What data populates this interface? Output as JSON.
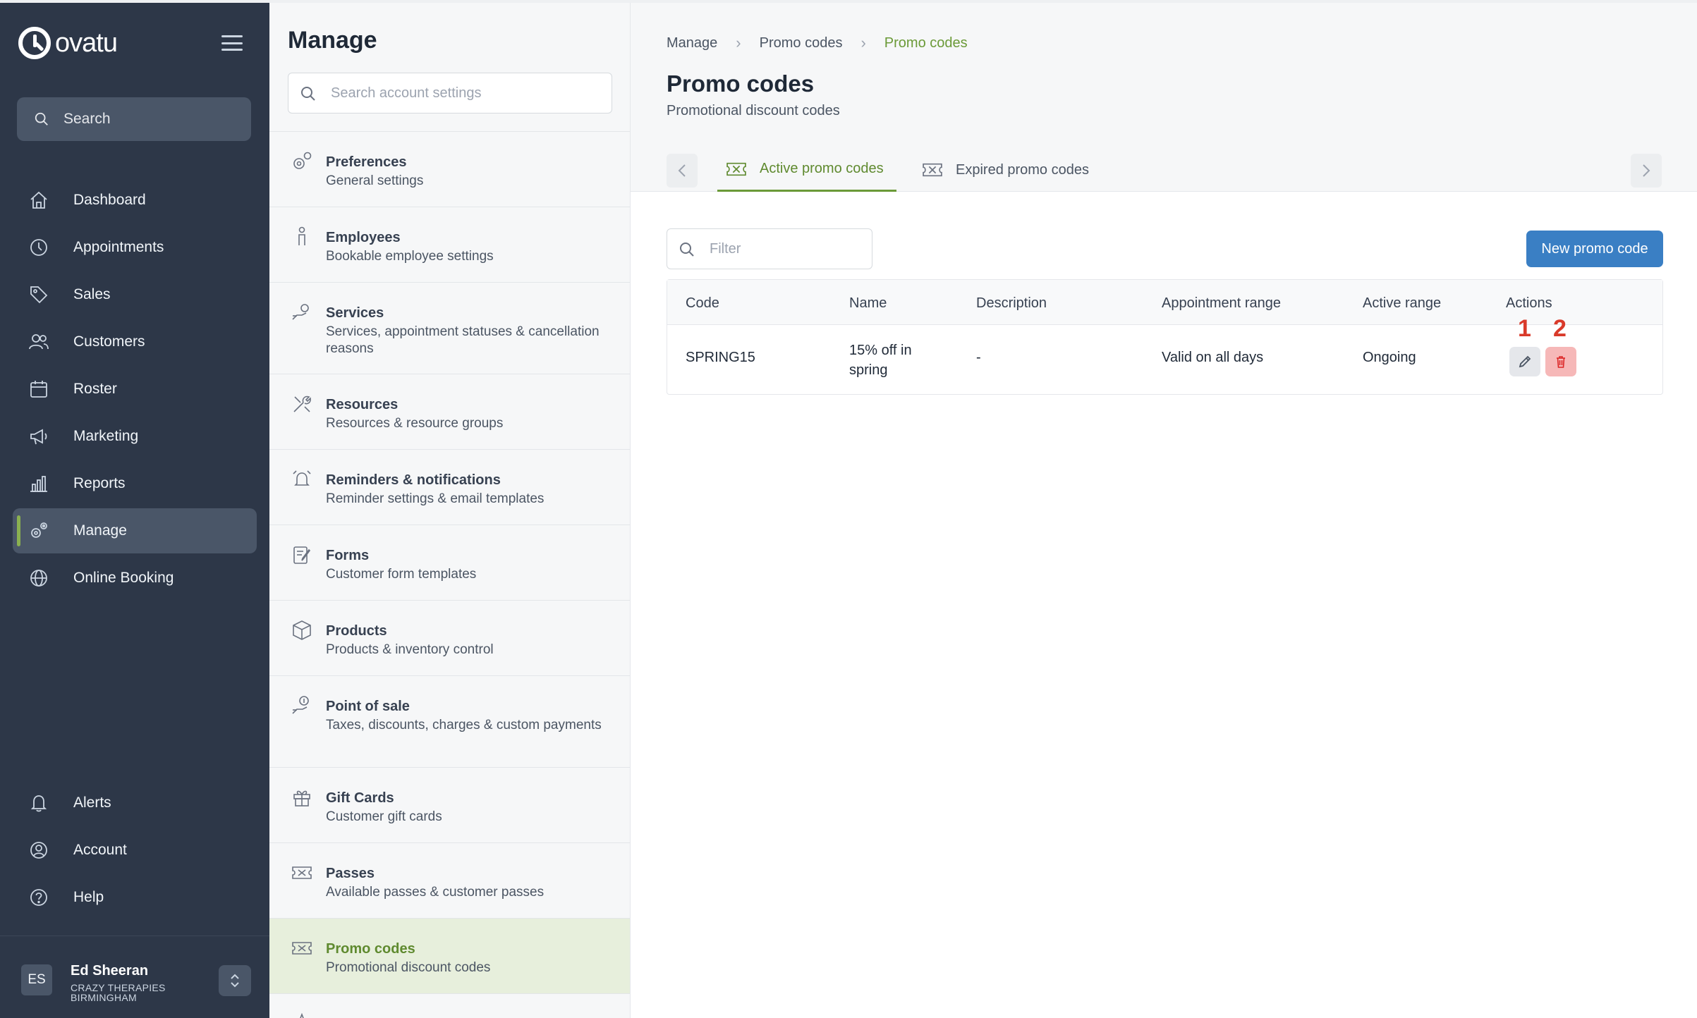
{
  "app": {
    "logo": "ovatu"
  },
  "nav": {
    "search_label": "Search",
    "items": [
      {
        "label": "Dashboard",
        "icon": "home-icon"
      },
      {
        "label": "Appointments",
        "icon": "clock-icon"
      },
      {
        "label": "Sales",
        "icon": "tag-icon"
      },
      {
        "label": "Customers",
        "icon": "users-icon"
      },
      {
        "label": "Roster",
        "icon": "calendar-icon"
      },
      {
        "label": "Marketing",
        "icon": "megaphone-icon"
      },
      {
        "label": "Reports",
        "icon": "bar-chart-icon"
      },
      {
        "label": "Manage",
        "icon": "gears-icon",
        "active": true
      },
      {
        "label": "Online Booking",
        "icon": "globe-icon"
      }
    ],
    "bottom_items": [
      {
        "label": "Alerts",
        "icon": "bell-icon"
      },
      {
        "label": "Account",
        "icon": "account-icon"
      },
      {
        "label": "Help",
        "icon": "help-icon"
      }
    ],
    "user": {
      "initials": "ES",
      "name": "Ed Sheeran",
      "company": "Crazy Therapies Birmingham"
    }
  },
  "settings": {
    "title": "Manage",
    "search_placeholder": "Search account settings",
    "items": [
      {
        "title": "Preferences",
        "subtitle": "General settings"
      },
      {
        "title": "Employees",
        "subtitle": "Bookable employee settings"
      },
      {
        "title": "Services",
        "subtitle": "Services, appointment statuses & cancellation reasons"
      },
      {
        "title": "Resources",
        "subtitle": "Resources & resource groups"
      },
      {
        "title": "Reminders & notifications",
        "subtitle": "Reminder settings & email templates"
      },
      {
        "title": "Forms",
        "subtitle": "Customer form templates"
      },
      {
        "title": "Products",
        "subtitle": "Products & inventory control"
      },
      {
        "title": "Point of sale",
        "subtitle": "Taxes, discounts, charges & custom payments"
      },
      {
        "title": "Gift Cards",
        "subtitle": "Customer gift cards"
      },
      {
        "title": "Passes",
        "subtitle": "Available passes & customer passes"
      },
      {
        "title": "Promo codes",
        "subtitle": "Promotional discount codes",
        "active": true
      }
    ]
  },
  "main": {
    "breadcrumb": [
      "Manage",
      "Promo codes",
      "Promo codes"
    ],
    "title": "Promo codes",
    "subtitle": "Promotional discount codes",
    "tabs": [
      {
        "label": "Active promo codes",
        "active": true
      },
      {
        "label": "Expired promo codes"
      }
    ],
    "filter_placeholder": "Filter",
    "new_button": "New promo code",
    "table": {
      "headers": [
        "Code",
        "Name",
        "Description",
        "Appointment range",
        "Active range",
        "Actions"
      ],
      "rows": [
        {
          "code": "SPRING15",
          "name": "15% off in spring",
          "description": "-",
          "appointment_range": "Valid on all days",
          "active_range": "Ongoing"
        }
      ]
    },
    "markers": [
      "1",
      "2"
    ]
  },
  "colors": {
    "nav_bg": "#2d3748",
    "accent_green": "#6b9a38",
    "primary_button": "#3a7fc4",
    "danger": "#f6b8b8"
  }
}
